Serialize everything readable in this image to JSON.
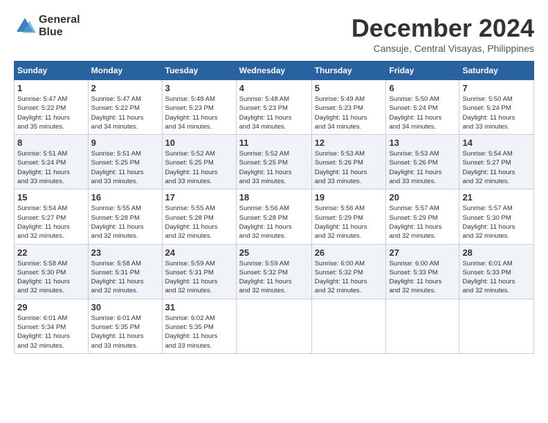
{
  "header": {
    "logo_line1": "General",
    "logo_line2": "Blue",
    "month": "December 2024",
    "location": "Cansuje, Central Visayas, Philippines"
  },
  "weekdays": [
    "Sunday",
    "Monday",
    "Tuesday",
    "Wednesday",
    "Thursday",
    "Friday",
    "Saturday"
  ],
  "weeks": [
    [
      {
        "day": "1",
        "info": "Sunrise: 5:47 AM\nSunset: 5:22 PM\nDaylight: 11 hours\nand 35 minutes."
      },
      {
        "day": "2",
        "info": "Sunrise: 5:47 AM\nSunset: 5:22 PM\nDaylight: 11 hours\nand 34 minutes."
      },
      {
        "day": "3",
        "info": "Sunrise: 5:48 AM\nSunset: 5:23 PM\nDaylight: 11 hours\nand 34 minutes."
      },
      {
        "day": "4",
        "info": "Sunrise: 5:48 AM\nSunset: 5:23 PM\nDaylight: 11 hours\nand 34 minutes."
      },
      {
        "day": "5",
        "info": "Sunrise: 5:49 AM\nSunset: 5:23 PM\nDaylight: 11 hours\nand 34 minutes."
      },
      {
        "day": "6",
        "info": "Sunrise: 5:50 AM\nSunset: 5:24 PM\nDaylight: 11 hours\nand 34 minutes."
      },
      {
        "day": "7",
        "info": "Sunrise: 5:50 AM\nSunset: 5:24 PM\nDaylight: 11 hours\nand 33 minutes."
      }
    ],
    [
      {
        "day": "8",
        "info": "Sunrise: 5:51 AM\nSunset: 5:24 PM\nDaylight: 11 hours\nand 33 minutes."
      },
      {
        "day": "9",
        "info": "Sunrise: 5:51 AM\nSunset: 5:25 PM\nDaylight: 11 hours\nand 33 minutes."
      },
      {
        "day": "10",
        "info": "Sunrise: 5:52 AM\nSunset: 5:25 PM\nDaylight: 11 hours\nand 33 minutes."
      },
      {
        "day": "11",
        "info": "Sunrise: 5:52 AM\nSunset: 5:25 PM\nDaylight: 11 hours\nand 33 minutes."
      },
      {
        "day": "12",
        "info": "Sunrise: 5:53 AM\nSunset: 5:26 PM\nDaylight: 11 hours\nand 33 minutes."
      },
      {
        "day": "13",
        "info": "Sunrise: 5:53 AM\nSunset: 5:26 PM\nDaylight: 11 hours\nand 33 minutes."
      },
      {
        "day": "14",
        "info": "Sunrise: 5:54 AM\nSunset: 5:27 PM\nDaylight: 11 hours\nand 32 minutes."
      }
    ],
    [
      {
        "day": "15",
        "info": "Sunrise: 5:54 AM\nSunset: 5:27 PM\nDaylight: 11 hours\nand 32 minutes."
      },
      {
        "day": "16",
        "info": "Sunrise: 5:55 AM\nSunset: 5:28 PM\nDaylight: 11 hours\nand 32 minutes."
      },
      {
        "day": "17",
        "info": "Sunrise: 5:55 AM\nSunset: 5:28 PM\nDaylight: 11 hours\nand 32 minutes."
      },
      {
        "day": "18",
        "info": "Sunrise: 5:56 AM\nSunset: 5:28 PM\nDaylight: 11 hours\nand 32 minutes."
      },
      {
        "day": "19",
        "info": "Sunrise: 5:56 AM\nSunset: 5:29 PM\nDaylight: 11 hours\nand 32 minutes."
      },
      {
        "day": "20",
        "info": "Sunrise: 5:57 AM\nSunset: 5:29 PM\nDaylight: 11 hours\nand 32 minutes."
      },
      {
        "day": "21",
        "info": "Sunrise: 5:57 AM\nSunset: 5:30 PM\nDaylight: 11 hours\nand 32 minutes."
      }
    ],
    [
      {
        "day": "22",
        "info": "Sunrise: 5:58 AM\nSunset: 5:30 PM\nDaylight: 11 hours\nand 32 minutes."
      },
      {
        "day": "23",
        "info": "Sunrise: 5:58 AM\nSunset: 5:31 PM\nDaylight: 11 hours\nand 32 minutes."
      },
      {
        "day": "24",
        "info": "Sunrise: 5:59 AM\nSunset: 5:31 PM\nDaylight: 11 hours\nand 32 minutes."
      },
      {
        "day": "25",
        "info": "Sunrise: 5:59 AM\nSunset: 5:32 PM\nDaylight: 11 hours\nand 32 minutes."
      },
      {
        "day": "26",
        "info": "Sunrise: 6:00 AM\nSunset: 5:32 PM\nDaylight: 11 hours\nand 32 minutes."
      },
      {
        "day": "27",
        "info": "Sunrise: 6:00 AM\nSunset: 5:33 PM\nDaylight: 11 hours\nand 32 minutes."
      },
      {
        "day": "28",
        "info": "Sunrise: 6:01 AM\nSunset: 5:33 PM\nDaylight: 11 hours\nand 32 minutes."
      }
    ],
    [
      {
        "day": "29",
        "info": "Sunrise: 6:01 AM\nSunset: 5:34 PM\nDaylight: 11 hours\nand 32 minutes."
      },
      {
        "day": "30",
        "info": "Sunrise: 6:01 AM\nSunset: 5:35 PM\nDaylight: 11 hours\nand 33 minutes."
      },
      {
        "day": "31",
        "info": "Sunrise: 6:02 AM\nSunset: 5:35 PM\nDaylight: 11 hours\nand 33 minutes."
      },
      null,
      null,
      null,
      null
    ]
  ]
}
